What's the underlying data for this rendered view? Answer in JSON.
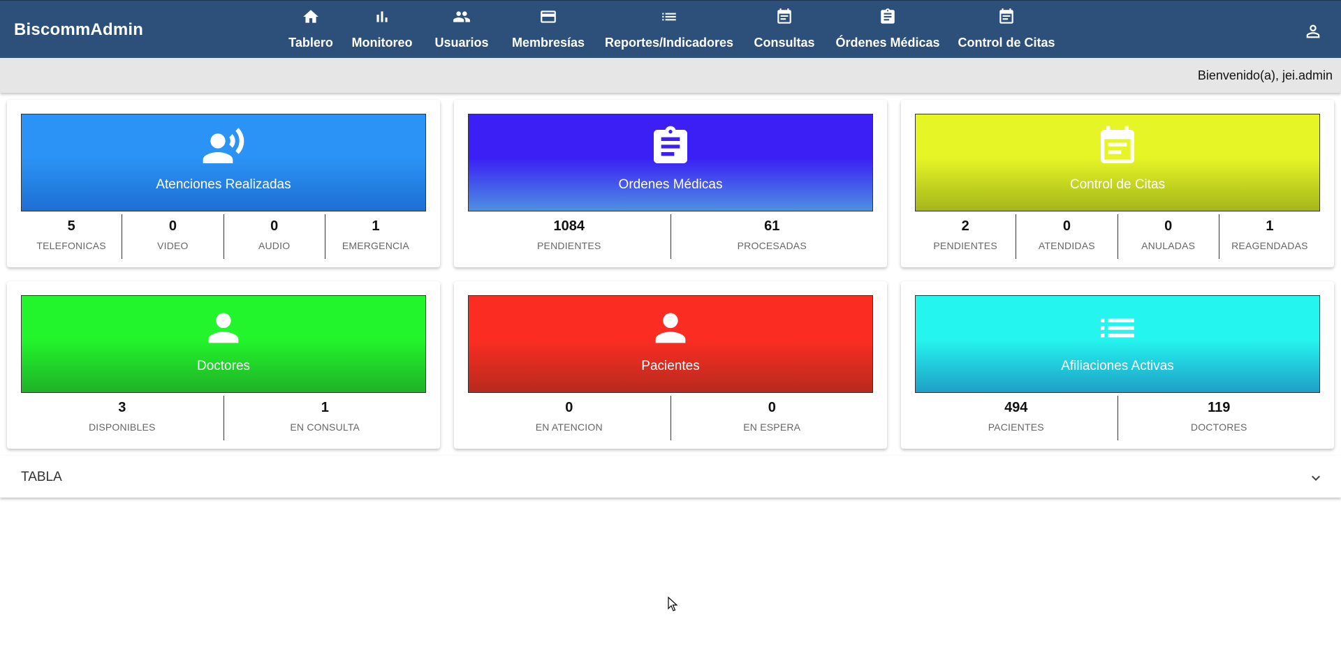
{
  "app": {
    "brand": "BiscommAdmin"
  },
  "nav": {
    "items": [
      {
        "label": "Tablero",
        "icon": "home-icon"
      },
      {
        "label": "Monitoreo",
        "icon": "bar-chart-icon"
      },
      {
        "label": "Usuarios",
        "icon": "people-icon"
      },
      {
        "label": "Membresías",
        "icon": "credit-card-icon"
      },
      {
        "label": "Reportes/Indicadores",
        "icon": "list-icon"
      },
      {
        "label": "Consultas",
        "icon": "event-note-icon"
      },
      {
        "label": "Órdenes Médicas",
        "icon": "clipboard-icon"
      },
      {
        "label": "Control de Citas",
        "icon": "event-note-icon"
      }
    ],
    "user_icon": "person-outline-icon"
  },
  "welcome": {
    "text": "Bienvenido(a), jei.admin"
  },
  "cards": [
    {
      "title": "Atenciones Realizadas",
      "icon": "record-voice-icon",
      "colors": [
        "#2b93f5",
        "#1e6fd4"
      ],
      "stats": [
        {
          "value": "5",
          "label": "TELEFONICAS"
        },
        {
          "value": "0",
          "label": "VIDEO"
        },
        {
          "value": "0",
          "label": "AUDIO"
        },
        {
          "value": "1",
          "label": "EMERGENCIA"
        }
      ]
    },
    {
      "title": "Ordenes Médicas",
      "icon": "clipboard-icon",
      "colors": [
        "#3b1ff5",
        "#4d90e0"
      ],
      "stats": [
        {
          "value": "1084",
          "label": "PENDIENTES"
        },
        {
          "value": "61",
          "label": "PROCESADAS"
        }
      ]
    },
    {
      "title": "Control de Citas",
      "icon": "event-note-icon",
      "colors": [
        "#e6f526",
        "#a4b51a"
      ],
      "stats": [
        {
          "value": "2",
          "label": "PENDIENTES"
        },
        {
          "value": "0",
          "label": "ATENDIDAS"
        },
        {
          "value": "0",
          "label": "ANULADAS"
        },
        {
          "value": "1",
          "label": "REAGENDADAS"
        }
      ]
    },
    {
      "title": "Doctores",
      "icon": "person-icon",
      "colors": [
        "#22f52b",
        "#1fb227"
      ],
      "stats": [
        {
          "value": "3",
          "label": "DISPONIBLES"
        },
        {
          "value": "1",
          "label": "EN CONSULTA"
        }
      ]
    },
    {
      "title": "Pacientes",
      "icon": "person-icon",
      "colors": [
        "#fb2d22",
        "#b82a1e"
      ],
      "stats": [
        {
          "value": "0",
          "label": "EN ATENCION"
        },
        {
          "value": "0",
          "label": "EN ESPERA"
        }
      ]
    },
    {
      "title": "Afiliaciones Activas",
      "icon": "list-icon",
      "colors": [
        "#25f5ef",
        "#1e9fc7"
      ],
      "stats": [
        {
          "value": "494",
          "label": "PACIENTES"
        },
        {
          "value": "119",
          "label": "DOCTORES"
        }
      ]
    }
  ],
  "table_panel": {
    "title": "TABLA",
    "icon": "chevron-down-icon"
  }
}
